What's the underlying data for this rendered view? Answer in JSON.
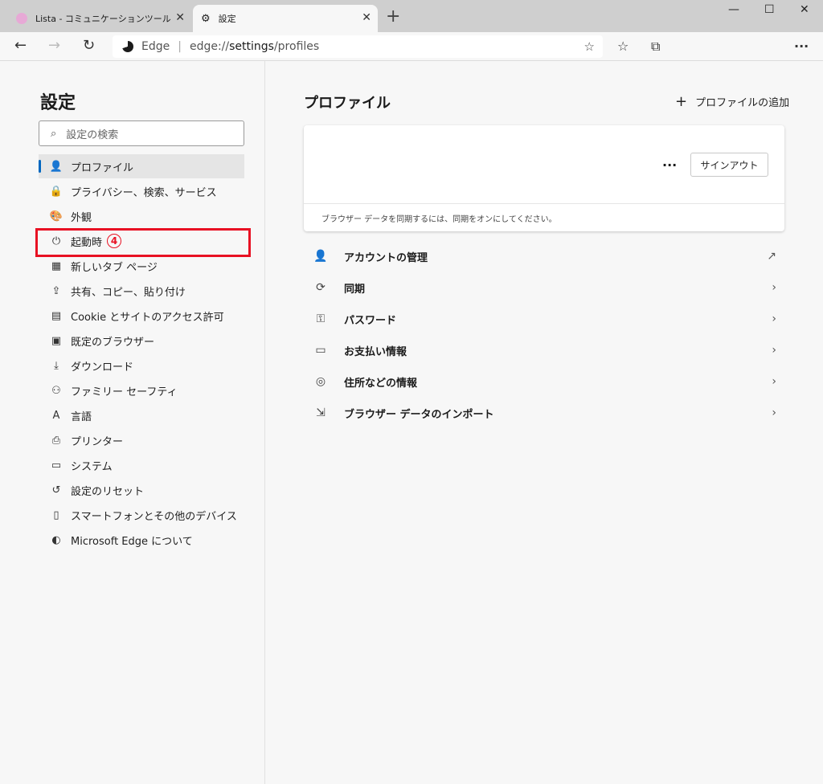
{
  "tabs": [
    {
      "title": "Lista - コミュニケーションツール",
      "close": "✕"
    },
    {
      "title": "設定",
      "close": "✕"
    }
  ],
  "new_tab": "+",
  "window_controls": {
    "minimize": "—",
    "maximize": "☐",
    "close": "✕"
  },
  "address": {
    "label": "Edge",
    "separator": "|",
    "url_prefix": "edge://",
    "url_bold": "settings",
    "url_rest": "/profiles"
  },
  "sidebar": {
    "title": "設定",
    "search_placeholder": "設定の検索",
    "items": [
      {
        "label": "プロファイル",
        "icon": "👤"
      },
      {
        "label": "プライバシー、検索、サービス",
        "icon": "🔒"
      },
      {
        "label": "外観",
        "icon": "🎨"
      },
      {
        "label": "起動時",
        "icon": "⏻",
        "badge": "4"
      },
      {
        "label": "新しいタブ ページ",
        "icon": "▦"
      },
      {
        "label": "共有、コピー、貼り付け",
        "icon": "⇪"
      },
      {
        "label": "Cookie とサイトのアクセス許可",
        "icon": "▤"
      },
      {
        "label": "既定のブラウザー",
        "icon": "▣"
      },
      {
        "label": "ダウンロード",
        "icon": "⤓"
      },
      {
        "label": "ファミリー セーフティ",
        "icon": "⚇"
      },
      {
        "label": "言語",
        "icon": "A"
      },
      {
        "label": "プリンター",
        "icon": "⎙"
      },
      {
        "label": "システム",
        "icon": "▭"
      },
      {
        "label": "設定のリセット",
        "icon": "↺"
      },
      {
        "label": "スマートフォンとその他のデバイス",
        "icon": "▯"
      },
      {
        "label": "Microsoft Edge について",
        "icon": "◐"
      }
    ]
  },
  "main": {
    "title": "プロファイル",
    "add_profile": "プロファイルの追加",
    "card": {
      "more": "···",
      "signout": "サインアウト",
      "sync_note": "ブラウザー データを同期するには、同期をオンにしてください。"
    },
    "rows": [
      {
        "label": "アカウントの管理",
        "icon": "👤",
        "trail": "↗"
      },
      {
        "label": "同期",
        "icon": "⟳",
        "trail": "›"
      },
      {
        "label": "パスワード",
        "icon": "⚿",
        "trail": "›"
      },
      {
        "label": "お支払い情報",
        "icon": "▭",
        "trail": "›"
      },
      {
        "label": "住所などの情報",
        "icon": "◎",
        "trail": "›"
      },
      {
        "label": "ブラウザー データのインポート",
        "icon": "⇲",
        "trail": "›"
      }
    ]
  }
}
